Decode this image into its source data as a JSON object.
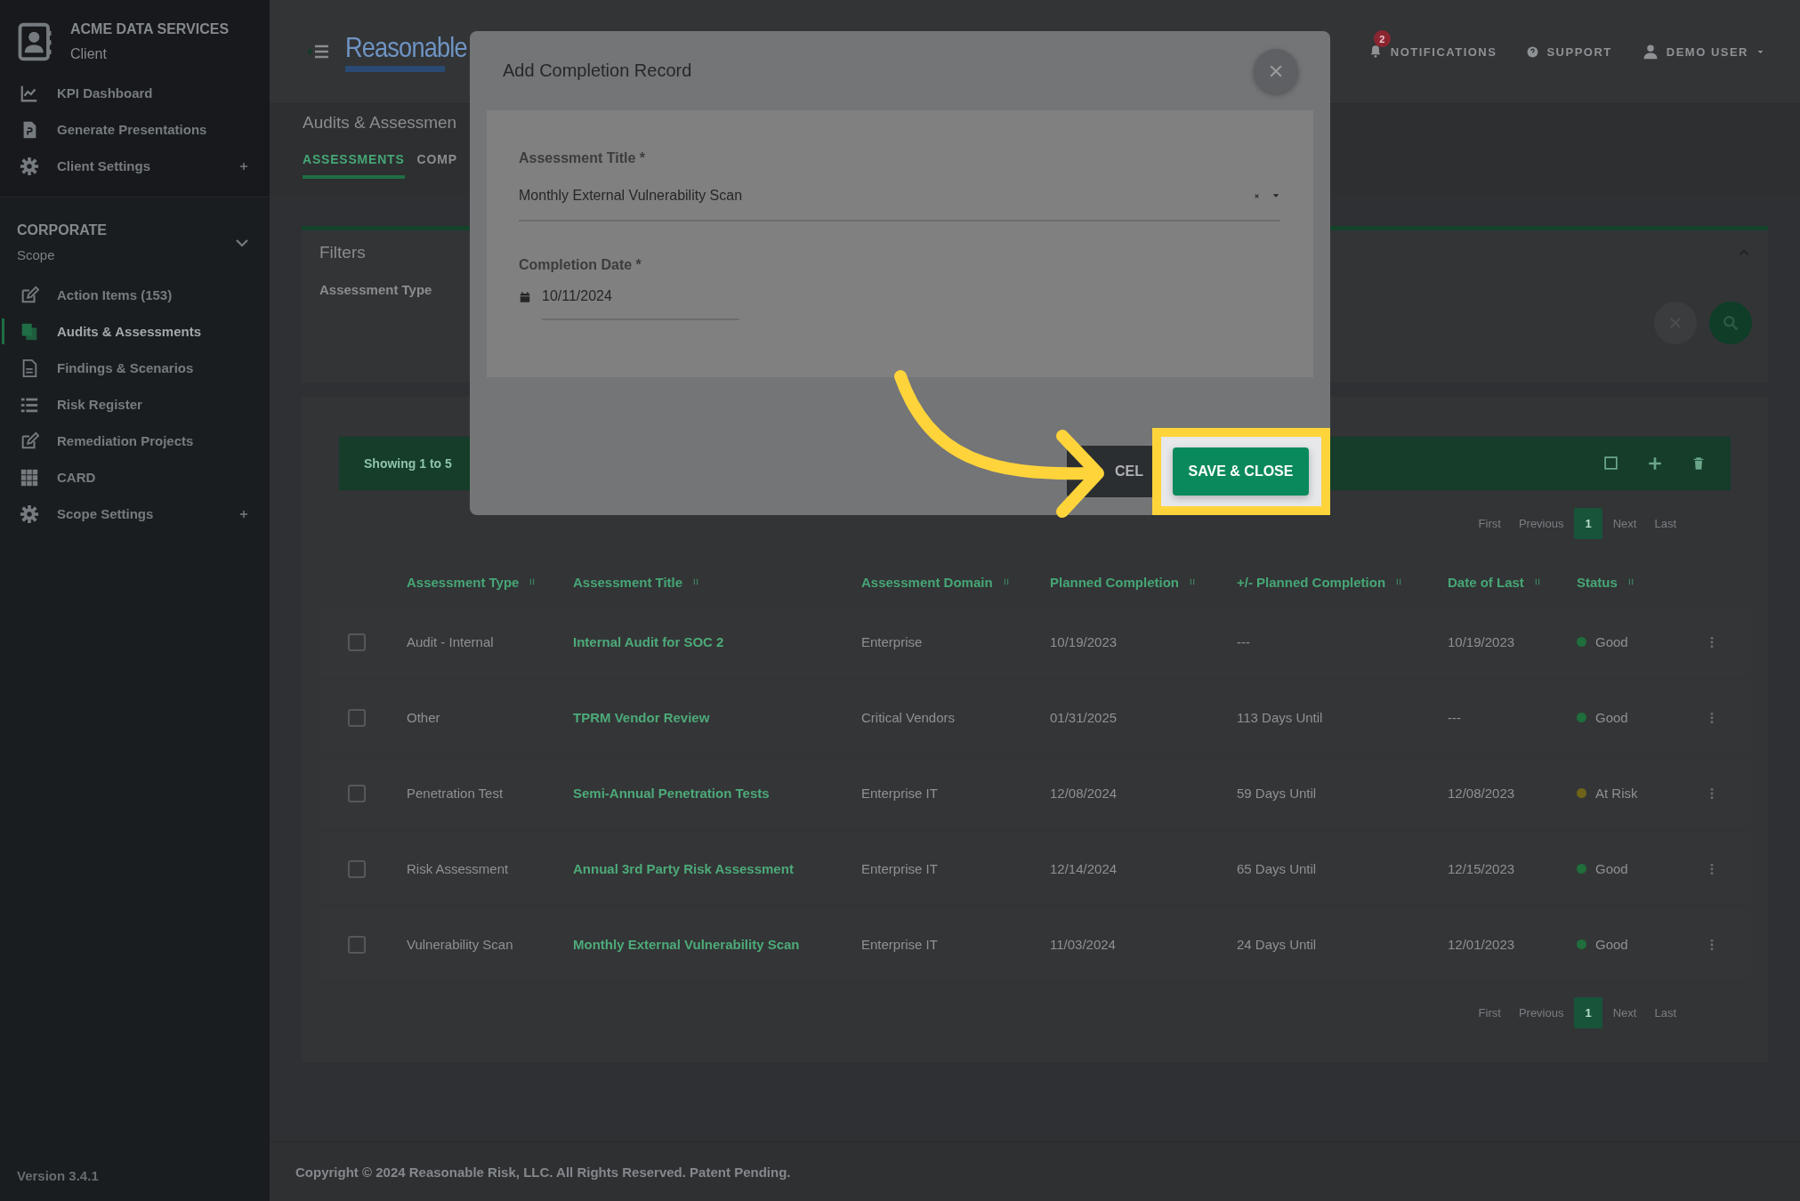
{
  "sidebar": {
    "client": {
      "name": "ACME DATA SERVICES",
      "subtitle": "Client"
    },
    "client_items": [
      {
        "label": "KPI Dashboard",
        "expandable": false
      },
      {
        "label": "Generate Presentations",
        "expandable": false
      },
      {
        "label": "Client Settings",
        "expandable": true
      }
    ],
    "scope": {
      "name": "CORPORATE",
      "subtitle": "Scope",
      "expanded": true
    },
    "scope_items": [
      {
        "label": "Action Items (153)",
        "selected": false,
        "expandable": false
      },
      {
        "label": "Audits & Assessments",
        "selected": true,
        "expandable": false
      },
      {
        "label": "Findings & Scenarios",
        "selected": false,
        "expandable": false
      },
      {
        "label": "Risk Register",
        "selected": false,
        "expandable": false
      },
      {
        "label": "Remediation Projects",
        "selected": false,
        "expandable": false
      },
      {
        "label": "CARD",
        "selected": false,
        "expandable": false
      },
      {
        "label": "Scope Settings",
        "selected": false,
        "expandable": true
      }
    ],
    "version": "Version 3.4.1"
  },
  "header": {
    "logo": "Reasonable",
    "notifications": {
      "label": "NOTIFICATIONS",
      "count": "2"
    },
    "support": "SUPPORT",
    "user": "DEMO USER"
  },
  "page": {
    "title": "Audits & Assessmen",
    "tabs": [
      {
        "label": "ASSESSMENTS",
        "selected": true
      },
      {
        "label": "COMP",
        "selected": false
      }
    ]
  },
  "filters": {
    "title": "Filters",
    "expanded": true,
    "fields": [
      {
        "label": "Assessment Type"
      }
    ]
  },
  "table": {
    "summary": "Showing 1 to 5",
    "pagination_top": [
      {
        "label": "First",
        "selected": false
      },
      {
        "label": "Previous",
        "selected": false
      },
      {
        "label": "1",
        "selected": true
      },
      {
        "label": "Next",
        "selected": false
      },
      {
        "label": "Last",
        "selected": false
      }
    ],
    "columns": [
      "Assessment Type",
      "Assessment Title",
      "Assessment Domain",
      "Planned Completion",
      "+/- Planned Completion",
      "Date of Last",
      "Status"
    ],
    "rows": [
      {
        "checked": false,
        "type": "Audit - Internal",
        "title": "Internal Audit for SOC 2",
        "domain": "Enterprise",
        "planned": "10/19/2023",
        "delta": "---",
        "last": "10/19/2023",
        "status": "Good",
        "color": "#1f6e3c"
      },
      {
        "checked": false,
        "type": "Other",
        "title": "TPRM Vendor Review",
        "domain": "Critical Vendors",
        "planned": "01/31/2025",
        "delta": "113 Days Until",
        "last": "---",
        "status": "Good",
        "color": "#1f6e3c"
      },
      {
        "checked": false,
        "type": "Penetration Test",
        "title": "Semi-Annual Penetration Tests",
        "domain": "Enterprise IT",
        "planned": "12/08/2024",
        "delta": "59 Days Until",
        "last": "12/08/2023",
        "status": "At Risk",
        "color": "#6e6419"
      },
      {
        "checked": false,
        "type": "Risk Assessment",
        "title": "Annual 3rd Party Risk Assessment",
        "domain": "Enterprise IT",
        "planned": "12/14/2024",
        "delta": "65 Days Until",
        "last": "12/15/2023",
        "status": "Good",
        "color": "#1f6e3c"
      },
      {
        "checked": false,
        "type": "Vulnerability Scan",
        "title": "Monthly External Vulnerability Scan",
        "domain": "Enterprise IT",
        "planned": "11/03/2024",
        "delta": "24 Days Until",
        "last": "12/01/2023",
        "status": "Good",
        "color": "#1f6e3c"
      }
    ],
    "pagination_bottom": [
      {
        "label": "First",
        "selected": false
      },
      {
        "label": "Previous",
        "selected": false
      },
      {
        "label": "1",
        "selected": true
      },
      {
        "label": "Next",
        "selected": false
      },
      {
        "label": "Last",
        "selected": false
      }
    ]
  },
  "modal": {
    "title": "Add Completion Record",
    "fields": [
      {
        "kind": "select",
        "label": "Assessment Title *",
        "value": "Monthly External Vulnerability Scan"
      },
      {
        "kind": "date",
        "label": "Completion Date *",
        "value": "10/11/2024"
      }
    ],
    "buttons": [
      {
        "kind": "secondary",
        "label": "CEL",
        "highlighted": false
      },
      {
        "kind": "primary",
        "label": "SAVE & CLOSE",
        "highlighted": true
      }
    ]
  },
  "footer": "Copyright © 2024 Reasonable Risk, LLC. All Rights Reserved. Patent Pending."
}
